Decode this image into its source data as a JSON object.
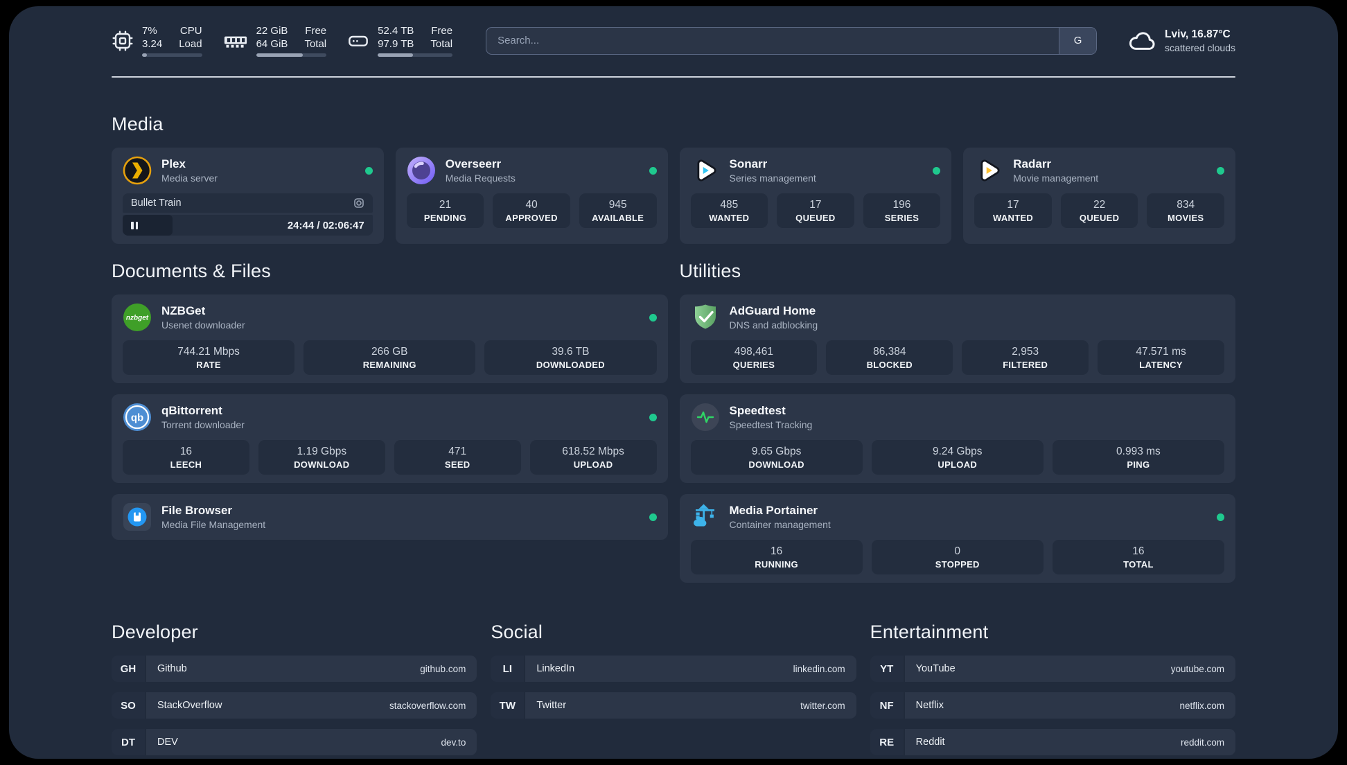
{
  "colors": {
    "page_bg": "#212b3c",
    "card_bg": "#2c3648",
    "box_bg": "#232d3e",
    "status_green": "#1fc98e",
    "plex_gold": "#e5a00d",
    "sonarr_blue": "#32c5f3",
    "radarr_yellow": "#fec232",
    "adguard_green": "#6cb475",
    "portainer_blue": "#3db3ea"
  },
  "topbar": {
    "cpu": {
      "icon": "cpu-icon",
      "percent": "7%",
      "load": "3.24",
      "label1": "CPU",
      "label2": "Load",
      "progress": 8
    },
    "memory": {
      "icon": "ram-icon",
      "free": "22 GiB",
      "total": "64 GiB",
      "label1": "Free",
      "label2": "Total",
      "progress": 66
    },
    "disk": {
      "icon": "disk-icon",
      "free": "52.4 TB",
      "total": "97.9 TB",
      "label1": "Free",
      "label2": "Total",
      "progress": 47
    },
    "search": {
      "placeholder": "Search...",
      "button_label": "G"
    },
    "weather": {
      "icon": "cloud-icon",
      "location": "Lviv, 16.87°C",
      "condition": "scattered clouds"
    }
  },
  "sections": {
    "media": "Media",
    "documents": "Documents & Files",
    "utilities": "Utilities",
    "developer": "Developer",
    "social": "Social",
    "entertainment": "Entertainment"
  },
  "services": {
    "plex": {
      "name": "Plex",
      "desc": "Media server",
      "status": "online",
      "nowplaying": {
        "title": "Bullet Train",
        "time": "24:44 / 02:06:47",
        "progress": 20
      }
    },
    "overseerr": {
      "name": "Overseerr",
      "desc": "Media Requests",
      "status": "online",
      "stats": [
        {
          "value": "21",
          "label": "PENDING"
        },
        {
          "value": "40",
          "label": "APPROVED"
        },
        {
          "value": "945",
          "label": "AVAILABLE"
        }
      ]
    },
    "sonarr": {
      "name": "Sonarr",
      "desc": "Series management",
      "status": "online",
      "stats": [
        {
          "value": "485",
          "label": "WANTED"
        },
        {
          "value": "17",
          "label": "QUEUED"
        },
        {
          "value": "196",
          "label": "SERIES"
        }
      ]
    },
    "radarr": {
      "name": "Radarr",
      "desc": "Movie management",
      "status": "online",
      "stats": [
        {
          "value": "17",
          "label": "WANTED"
        },
        {
          "value": "22",
          "label": "QUEUED"
        },
        {
          "value": "834",
          "label": "MOVIES"
        }
      ]
    },
    "nzbget": {
      "name": "NZBGet",
      "desc": "Usenet downloader",
      "status": "online",
      "stats": [
        {
          "value": "744.21 Mbps",
          "label": "RATE"
        },
        {
          "value": "266 GB",
          "label": "REMAINING"
        },
        {
          "value": "39.6 TB",
          "label": "DOWNLOADED"
        }
      ]
    },
    "qbittorrent": {
      "name": "qBittorrent",
      "desc": "Torrent downloader",
      "status": "online",
      "stats": [
        {
          "value": "16",
          "label": "LEECH"
        },
        {
          "value": "1.19 Gbps",
          "label": "DOWNLOAD"
        },
        {
          "value": "471",
          "label": "SEED"
        },
        {
          "value": "618.52 Mbps",
          "label": "UPLOAD"
        }
      ]
    },
    "filebrowser": {
      "name": "File Browser",
      "desc": "Media File Management",
      "status": "online"
    },
    "adguard": {
      "name": "AdGuard Home",
      "desc": "DNS and adblocking",
      "stats": [
        {
          "value": "498,461",
          "label": "QUERIES"
        },
        {
          "value": "86,384",
          "label": "BLOCKED"
        },
        {
          "value": "2,953",
          "label": "FILTERED"
        },
        {
          "value": "47.571 ms",
          "label": "LATENCY"
        }
      ]
    },
    "speedtest": {
      "name": "Speedtest",
      "desc": "Speedtest Tracking",
      "stats": [
        {
          "value": "9.65 Gbps",
          "label": "DOWNLOAD"
        },
        {
          "value": "9.24 Gbps",
          "label": "UPLOAD"
        },
        {
          "value": "0.993 ms",
          "label": "PING"
        }
      ]
    },
    "portainer": {
      "name": "Media Portainer",
      "desc": "Container management",
      "status": "online",
      "stats": [
        {
          "value": "16",
          "label": "RUNNING"
        },
        {
          "value": "0",
          "label": "STOPPED"
        },
        {
          "value": "16",
          "label": "TOTAL"
        }
      ]
    }
  },
  "bookmarks": {
    "developer": [
      {
        "abbr": "GH",
        "name": "Github",
        "url": "github.com"
      },
      {
        "abbr": "SO",
        "name": "StackOverflow",
        "url": "stackoverflow.com"
      },
      {
        "abbr": "DT",
        "name": "DEV",
        "url": "dev.to"
      }
    ],
    "social": [
      {
        "abbr": "LI",
        "name": "LinkedIn",
        "url": "linkedin.com"
      },
      {
        "abbr": "TW",
        "name": "Twitter",
        "url": "twitter.com"
      }
    ],
    "entertainment": [
      {
        "abbr": "YT",
        "name": "YouTube",
        "url": "youtube.com"
      },
      {
        "abbr": "NF",
        "name": "Netflix",
        "url": "netflix.com"
      },
      {
        "abbr": "RE",
        "name": "Reddit",
        "url": "reddit.com"
      }
    ]
  }
}
